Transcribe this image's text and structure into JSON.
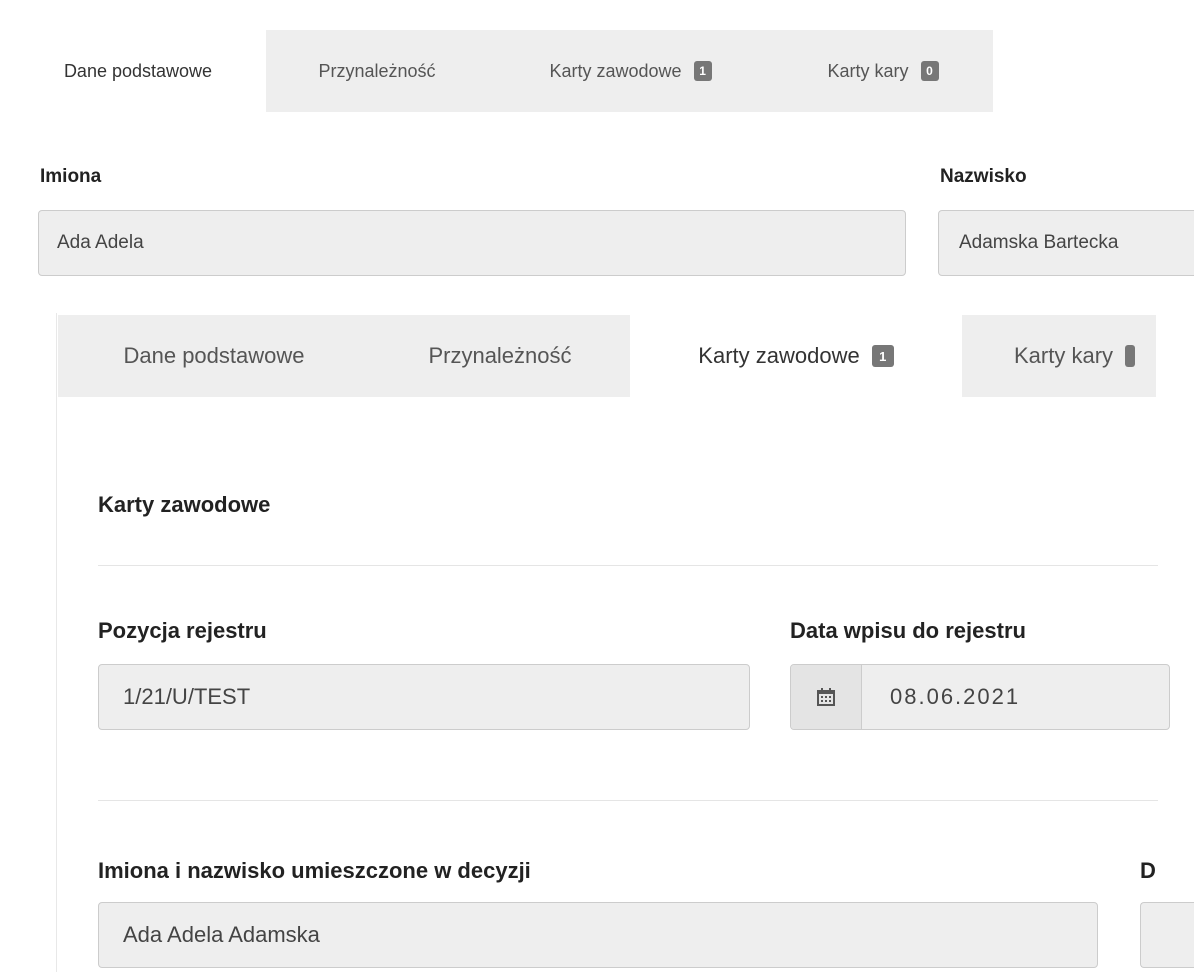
{
  "outer_tabs": [
    {
      "label": "Dane podstawowe",
      "badge": null,
      "active": true
    },
    {
      "label": "Przynależność",
      "badge": null,
      "active": false
    },
    {
      "label": "Karty zawodowe",
      "badge": "1",
      "active": false
    },
    {
      "label": "Karty kary",
      "badge": "0",
      "active": false
    }
  ],
  "fields": {
    "imiona_label": "Imiona",
    "imiona_value": "Ada Adela",
    "nazwisko_label": "Nazwisko",
    "nazwisko_value": "Adamska Bartecka"
  },
  "inner_tabs": [
    {
      "label": "Dane podstawowe",
      "badge": null,
      "active": false
    },
    {
      "label": "Przynależność",
      "badge": null,
      "active": false
    },
    {
      "label": "Karty zawodowe",
      "badge": "1",
      "active": true
    },
    {
      "label": "Karty kary",
      "badge": "",
      "active": false
    }
  ],
  "section": {
    "title": "Karty zawodowe",
    "pozycja_label": "Pozycja rejestru",
    "pozycja_value": "1/21/U/TEST",
    "data_label": "Data wpisu do rejestru",
    "data_value": "08.06.2021",
    "imiona_nazwisko_label": "Imiona i nazwisko umieszczone w decyzji",
    "imiona_nazwisko_value": "Ada Adela Adamska",
    "cut_label": "D"
  },
  "icons": {
    "calendar": "calendar-icon"
  },
  "colors": {
    "tab_inactive": "#eeeeee",
    "badge": "#777777",
    "input_bg": "#eeeeee",
    "border": "#cccccc"
  }
}
